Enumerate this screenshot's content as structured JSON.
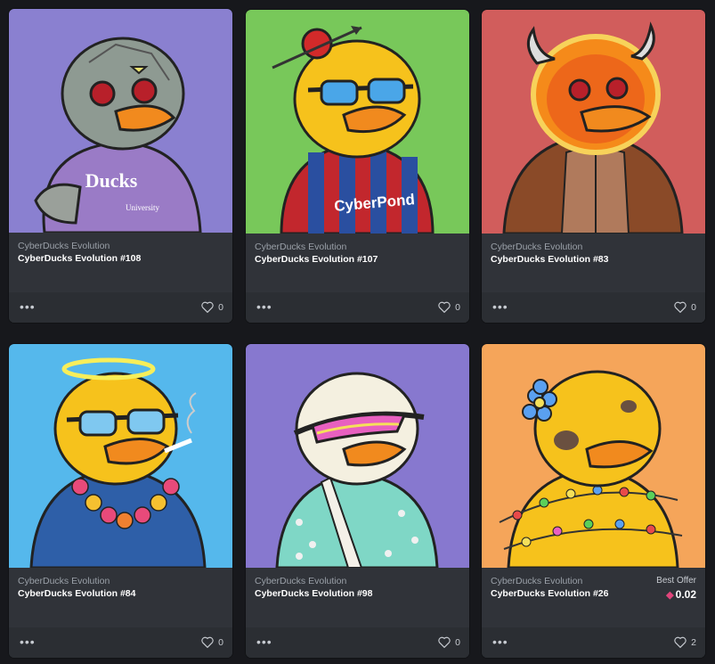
{
  "cards": [
    {
      "collection": "CyberDucks Evolution",
      "name": "CyberDucks Evolution #108",
      "likes": "0",
      "bg": "#8a80d0"
    },
    {
      "collection": "CyberDucks Evolution",
      "name": "CyberDucks Evolution #107",
      "likes": "0",
      "bg": "#78c85a"
    },
    {
      "collection": "CyberDucks Evolution",
      "name": "CyberDucks Evolution #83",
      "likes": "0",
      "bg": "#d15d5c"
    },
    {
      "collection": "CyberDucks Evolution",
      "name": "CyberDucks Evolution #84",
      "likes": "0",
      "bg": "#55b8ec"
    },
    {
      "collection": "CyberDucks Evolution",
      "name": "CyberDucks Evolution #98",
      "likes": "0",
      "bg": "#8778cf"
    },
    {
      "collection": "CyberDucks Evolution",
      "name": "CyberDucks Evolution #26",
      "likes": "2",
      "bg": "#f5a55a",
      "offer_label": "Best Offer",
      "offer_price": "0.02"
    }
  ],
  "art_text": {
    "hoodie": "Ducks",
    "hoodie_sub": "University",
    "shirt": "CyberPond"
  },
  "colors": {
    "card_bg": "#303339",
    "footer_bg": "#2b2e33",
    "page_bg": "#17181c",
    "duck_yellow": "#f6c21c",
    "beak_orange": "#f18a1e"
  },
  "icons": [
    "more-dots-icon",
    "heart-icon",
    "eth-icon"
  ]
}
